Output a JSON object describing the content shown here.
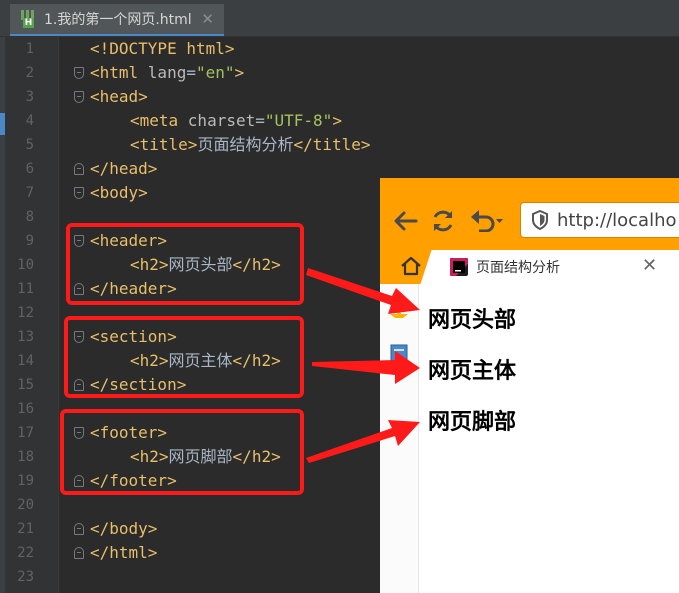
{
  "editor": {
    "tab_title": "1.我的第一个网页.html",
    "tab_close": "✕",
    "lines": [
      {
        "n": "1",
        "parts": [
          [
            "doc",
            "<!DOCTYPE html>"
          ]
        ],
        "indent": 0
      },
      {
        "n": "2",
        "parts": [
          [
            "tag",
            "<html "
          ],
          [
            "attr",
            "lang"
          ],
          [
            "txt",
            "="
          ],
          [
            "val",
            "\"en\""
          ],
          [
            "tag",
            ">"
          ]
        ],
        "indent": 0,
        "fold": "open"
      },
      {
        "n": "3",
        "parts": [
          [
            "tag",
            "<head>"
          ]
        ],
        "indent": 0,
        "fold": "open"
      },
      {
        "n": "4",
        "parts": [
          [
            "tag",
            "<meta "
          ],
          [
            "attr",
            "charset"
          ],
          [
            "txt",
            "="
          ],
          [
            "val",
            "\"UTF-8\""
          ],
          [
            "tag",
            ">"
          ]
        ],
        "indent": 1
      },
      {
        "n": "5",
        "parts": [
          [
            "tag",
            "<title>"
          ],
          [
            "txt",
            "页面结构分析"
          ],
          [
            "tag",
            "</title>"
          ]
        ],
        "indent": 1
      },
      {
        "n": "6",
        "parts": [
          [
            "tag",
            "</head>"
          ]
        ],
        "indent": 0,
        "fold": "close"
      },
      {
        "n": "7",
        "parts": [
          [
            "tag",
            "<body>"
          ]
        ],
        "indent": 0,
        "fold": "open"
      },
      {
        "n": "8",
        "parts": [],
        "indent": 0
      },
      {
        "n": "9",
        "parts": [
          [
            "tag",
            "<header>"
          ]
        ],
        "indent": 0,
        "fold": "open"
      },
      {
        "n": "10",
        "parts": [
          [
            "tag",
            "<h2>"
          ],
          [
            "txt",
            "网页头部"
          ],
          [
            "tag",
            "</h2>"
          ]
        ],
        "indent": 1
      },
      {
        "n": "11",
        "parts": [
          [
            "tag",
            "</header>"
          ]
        ],
        "indent": 0,
        "fold": "close"
      },
      {
        "n": "12",
        "parts": [],
        "indent": 0
      },
      {
        "n": "13",
        "parts": [
          [
            "tag",
            "<section>"
          ]
        ],
        "indent": 0,
        "fold": "open"
      },
      {
        "n": "14",
        "parts": [
          [
            "tag",
            "<h2>"
          ],
          [
            "txt",
            "网页主体"
          ],
          [
            "tag",
            "</h2>"
          ]
        ],
        "indent": 1
      },
      {
        "n": "15",
        "parts": [
          [
            "tag",
            "</section>"
          ]
        ],
        "indent": 0,
        "fold": "close"
      },
      {
        "n": "16",
        "parts": [],
        "indent": 0
      },
      {
        "n": "17",
        "parts": [
          [
            "tag",
            "<footer>"
          ]
        ],
        "indent": 0,
        "fold": "open"
      },
      {
        "n": "18",
        "parts": [
          [
            "tag",
            "<h2>"
          ],
          [
            "txt",
            "网页脚部"
          ],
          [
            "tag",
            "</h2>"
          ]
        ],
        "indent": 1
      },
      {
        "n": "19",
        "parts": [
          [
            "tag",
            "</footer>"
          ]
        ],
        "indent": 0,
        "fold": "close"
      },
      {
        "n": "20",
        "parts": [],
        "indent": 0
      },
      {
        "n": "21",
        "parts": [
          [
            "tag",
            "</body>"
          ]
        ],
        "indent": 0,
        "fold": "close"
      },
      {
        "n": "22",
        "parts": [
          [
            "tag",
            "</html>"
          ]
        ],
        "indent": 0,
        "fold": "close"
      },
      {
        "n": "23",
        "parts": [],
        "indent": 0
      }
    ]
  },
  "browser": {
    "url": "http://localho",
    "tab_title": "页面结构分析",
    "tab_close": "✕",
    "headings": [
      "网页头部",
      "网页主体",
      "网页脚部"
    ]
  },
  "colors": {
    "annotation_red": "#ff1a1a",
    "toolbar_orange": "#ff9f00",
    "editor_bg": "#2b2b2b",
    "tag": "#e8bf6a",
    "string": "#a5c25c"
  }
}
